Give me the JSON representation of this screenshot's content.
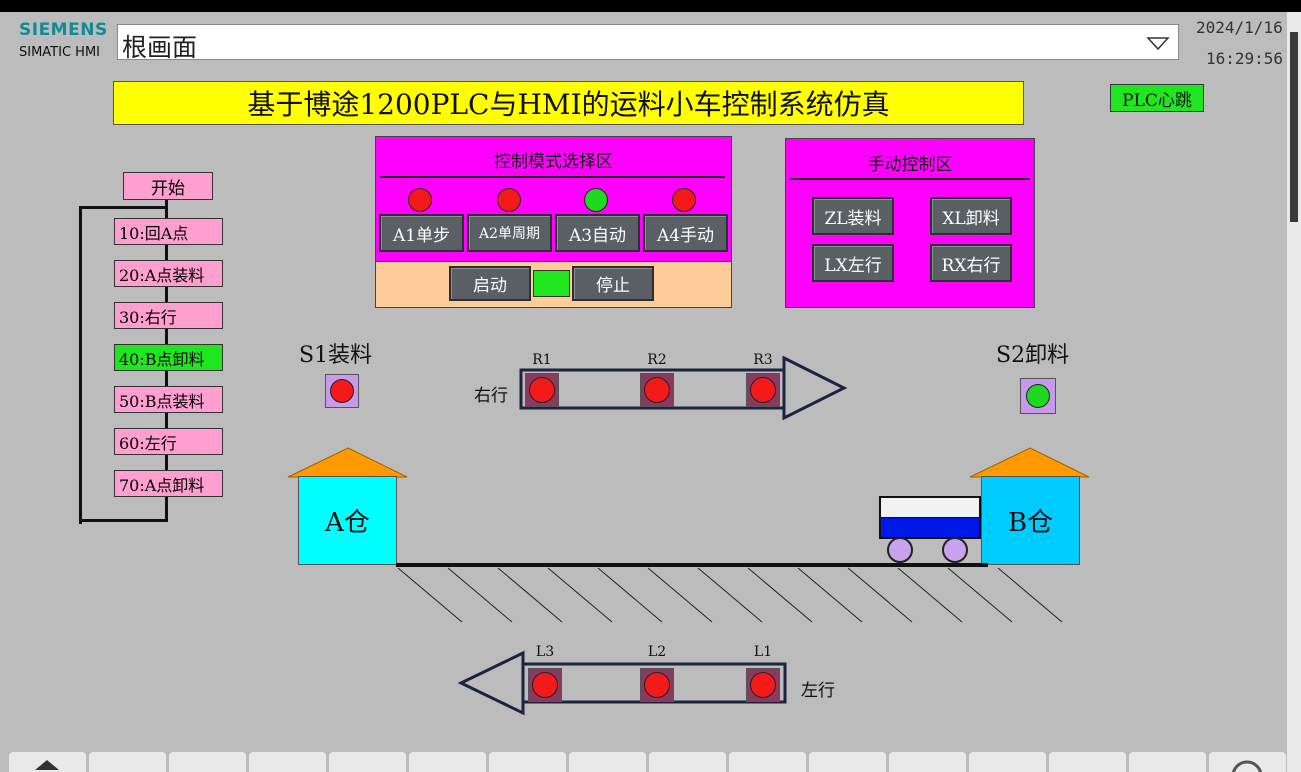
{
  "header": {
    "brand_top": "SIEMENS",
    "brand_bottom": "SIMATIC HMI",
    "screen_name": "根画面",
    "date": "2024/1/16",
    "time": "16:29:56"
  },
  "title": "基于博途1200PLC与HMI的运料小车控制系统仿真",
  "heartbeat_label": "PLC心跳",
  "sequence": {
    "start_label": "开始",
    "steps": [
      {
        "label": "10:回A点",
        "active": false
      },
      {
        "label": "20:A点装料",
        "active": false
      },
      {
        "label": "30:右行",
        "active": false
      },
      {
        "label": "40:B点卸料",
        "active": true
      },
      {
        "label": "50:B点装料",
        "active": false
      },
      {
        "label": "60:左行",
        "active": false
      },
      {
        "label": "70:A点卸料",
        "active": false
      }
    ]
  },
  "mode_panel": {
    "title": "控制模式选择区",
    "modes": [
      {
        "label": "A1单步",
        "indicator": "red"
      },
      {
        "label": "A2单周期",
        "indicator": "red"
      },
      {
        "label": "A3自动",
        "indicator": "green"
      },
      {
        "label": "A4手动",
        "indicator": "red"
      }
    ],
    "start_label": "启动",
    "stop_label": "停止",
    "run_indicator": "green"
  },
  "manual_panel": {
    "title": "手动控制区",
    "buttons": [
      "ZL装料",
      "XL卸料",
      "LX左行",
      "RX右行"
    ]
  },
  "station_a": {
    "sensor_label": "S1装料",
    "sensor_state": "red",
    "warehouse_label": "A仓"
  },
  "station_b": {
    "sensor_label": "S2卸料",
    "sensor_state": "green",
    "warehouse_label": "B仓"
  },
  "right_track": {
    "label": "右行",
    "lamps": [
      {
        "name": "R1",
        "state": "red"
      },
      {
        "name": "R2",
        "state": "red"
      },
      {
        "name": "R3",
        "state": "red"
      }
    ]
  },
  "left_track": {
    "label": "左行",
    "lamps": [
      {
        "name": "L3",
        "state": "red"
      },
      {
        "name": "L2",
        "state": "red"
      },
      {
        "name": "L1",
        "state": "red"
      }
    ]
  },
  "colors": {
    "background": "#bcbcbc",
    "title_bar": "#ffff00",
    "panel": "#ff00ff",
    "control_strip": "#ffcc99",
    "step_inactive": "#ff9fcf",
    "step_active": "#1fe61f",
    "warehouse": "#00e5ff",
    "roof": "#ff9900"
  }
}
